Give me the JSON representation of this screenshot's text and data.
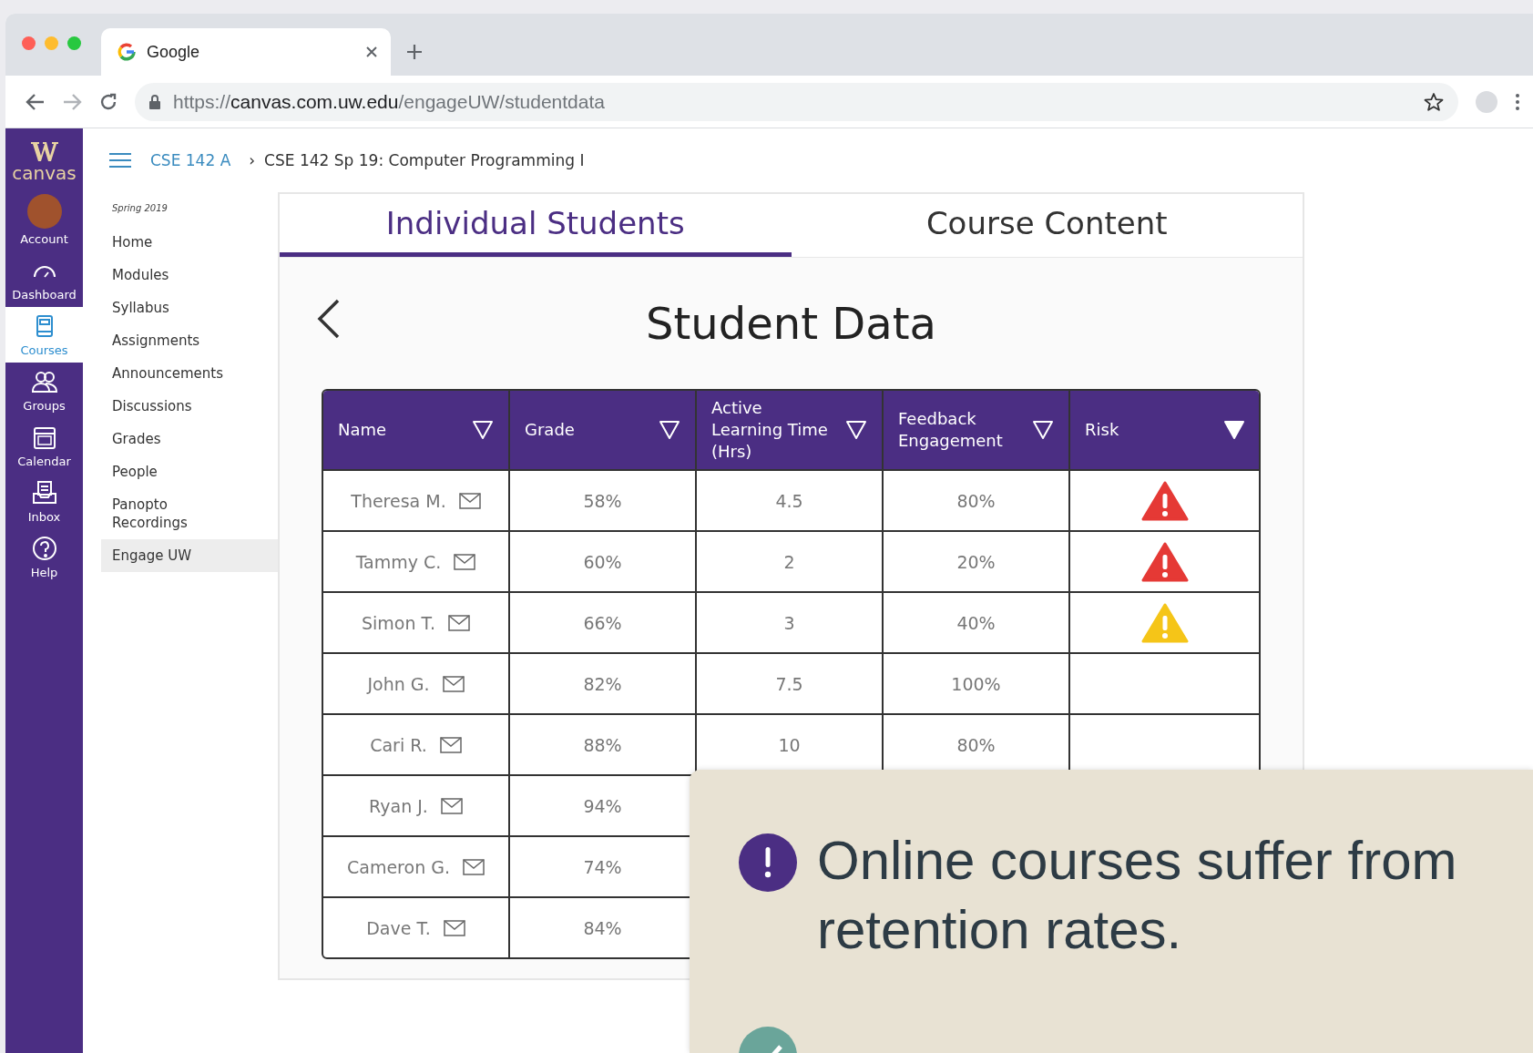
{
  "browser": {
    "tab_title": "Google",
    "url": {
      "scheme": "https://",
      "host": "canvas.com.uw.edu",
      "path": "/engageUW/studentdata"
    }
  },
  "global_nav": {
    "logo_text": "canvas",
    "items": [
      {
        "label": "Account",
        "kind": "avatar",
        "selected": false
      },
      {
        "label": "Dashboard",
        "kind": "dashboard",
        "selected": false
      },
      {
        "label": "Courses",
        "kind": "courses",
        "selected": true
      },
      {
        "label": "Groups",
        "kind": "groups",
        "selected": false
      },
      {
        "label": "Calendar",
        "kind": "calendar",
        "selected": false
      },
      {
        "label": "Inbox",
        "kind": "inbox",
        "selected": false
      },
      {
        "label": "Help",
        "kind": "help",
        "selected": false
      }
    ]
  },
  "breadcrumb": {
    "course": "CSE 142 A",
    "separator": "›",
    "page": "CSE 142 Sp 19: Computer Programming I"
  },
  "course_nav": {
    "term": "Spring 2019",
    "items": [
      {
        "label": "Home",
        "selected": false
      },
      {
        "label": "Modules",
        "selected": false
      },
      {
        "label": "Syllabus",
        "selected": false
      },
      {
        "label": "Assignments",
        "selected": false
      },
      {
        "label": "Announcements",
        "selected": false
      },
      {
        "label": "Discussions",
        "selected": false
      },
      {
        "label": "Grades",
        "selected": false
      },
      {
        "label": "People",
        "selected": false
      },
      {
        "label": "Panopto Recordings",
        "selected": false
      },
      {
        "label": "Engage UW",
        "selected": true
      }
    ]
  },
  "tabs": [
    {
      "label": "Individual Students",
      "selected": true
    },
    {
      "label": "Course Content",
      "selected": false
    }
  ],
  "title": "Student Data",
  "table": {
    "columns": [
      {
        "label": "Name",
        "filtered": false
      },
      {
        "label": "Grade",
        "filtered": false
      },
      {
        "label": "Active Learning Time (Hrs)",
        "filtered": false
      },
      {
        "label": "Feedback Engagement",
        "filtered": false
      },
      {
        "label": "Risk",
        "filtered": true
      }
    ],
    "rows": [
      {
        "name": "Theresa M.",
        "grade": "58%",
        "time": "4.5",
        "feedback": "80%",
        "color": "#e53935"
      },
      {
        "name": "Tammy C.",
        "grade": "60%",
        "time": "2",
        "feedback": "20%",
        "color": "#e53935"
      },
      {
        "name": "Simon T.",
        "grade": "66%",
        "time": "3",
        "feedback": "40%",
        "color": "#f5c518"
      },
      {
        "name": "John G.",
        "grade": "82%",
        "time": "7.5",
        "feedback": "100%"
      },
      {
        "name": "Cari R.",
        "grade": "88%",
        "time": "10",
        "feedback": "80%"
      },
      {
        "name": "Ryan J.",
        "grade": "94%"
      },
      {
        "name": "Cameron G.",
        "grade": "74%"
      },
      {
        "name": "Dave T.",
        "grade": "84%"
      }
    ]
  },
  "callout": {
    "points": [
      {
        "kind": "alert",
        "text": "Online courses suffer from retention rates."
      },
      {
        "kind": "check"
      }
    ]
  }
}
